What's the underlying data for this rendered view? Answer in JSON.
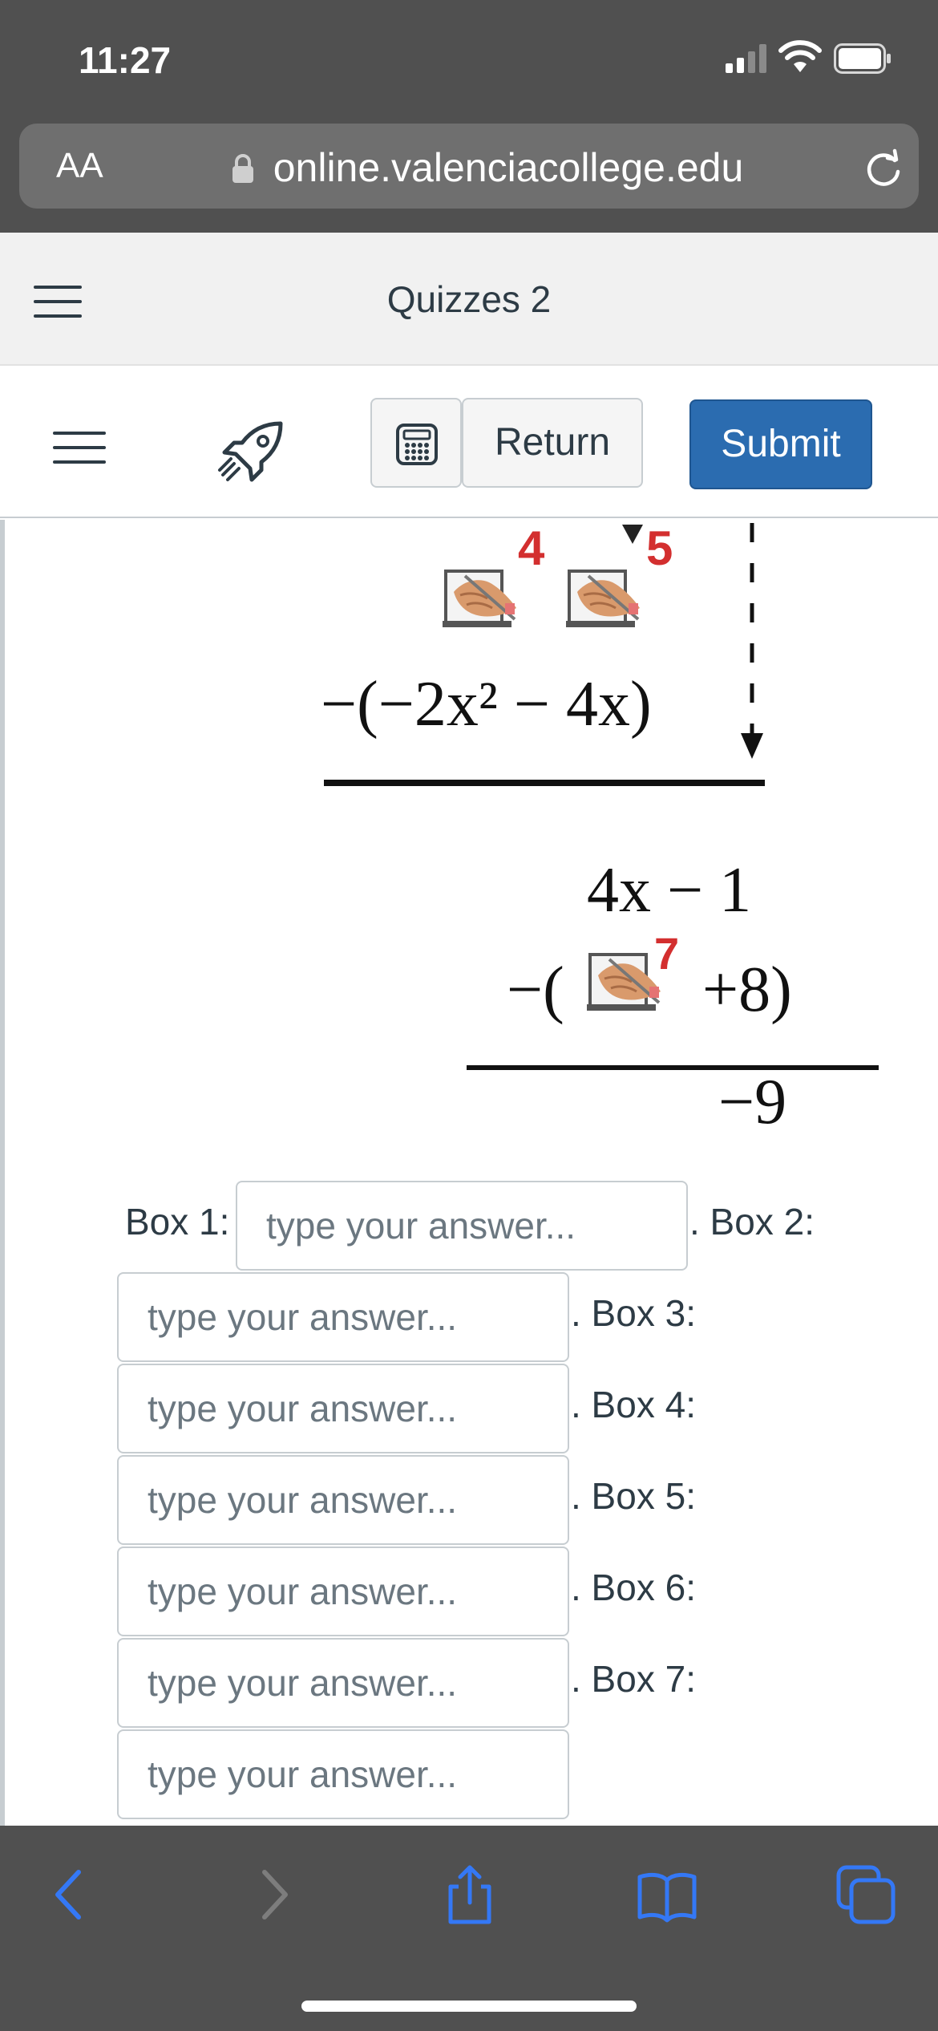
{
  "status_bar": {
    "time": "11:27"
  },
  "browser": {
    "text_size_label": "AA",
    "url": "online.valenciacollege.edu"
  },
  "header": {
    "title": "Quizzes 2"
  },
  "toolbar": {
    "return_label": "Return",
    "submit_label": "Submit"
  },
  "math_figure": {
    "marker_4": "4",
    "marker_5": "5",
    "marker_7": "7",
    "line1": "−(−2x² − 4x)",
    "line2": "4x − 1",
    "line3_prefix": "−(",
    "line3_suffix": "+8)",
    "remainder": "−9"
  },
  "boxes": {
    "placeholder": "type your answer...",
    "labels": [
      "Box 1:",
      ". Box 2:",
      ". Box 3:",
      ". Box 4:",
      ". Box 5:",
      ". Box 6:",
      ". Box 7:"
    ]
  },
  "colors": {
    "browser_chrome": "#505050",
    "submit_blue": "#2b6cb0",
    "text_dark": "#2d3b45",
    "marker_red": "#d32f2f",
    "ios_blue": "#3478f6"
  },
  "icons": {
    "toolbar": [
      "hamburger-icon",
      "rocket-icon",
      "calculator-icon"
    ],
    "bottom_nav": [
      "back-chevron-icon",
      "forward-chevron-icon",
      "share-icon",
      "bookmarks-icon",
      "tabs-icon"
    ]
  }
}
